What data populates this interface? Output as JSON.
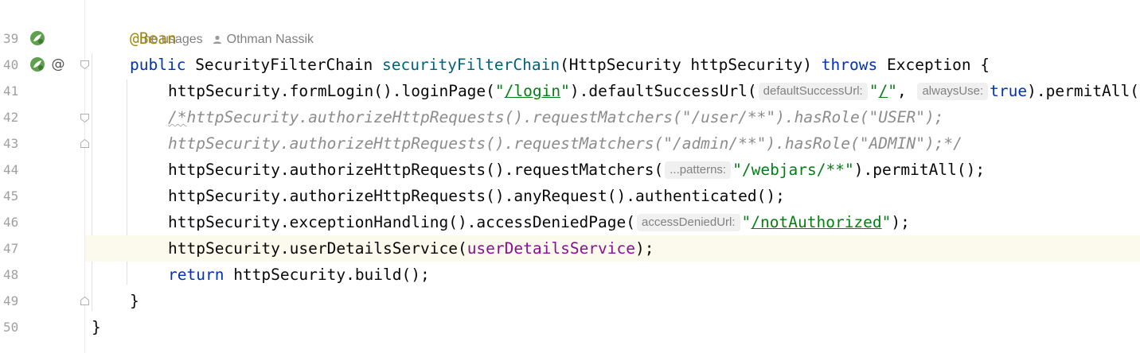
{
  "header_hint": {
    "usages": "no usages",
    "author": "Othman Nassik"
  },
  "line_numbers": [
    "39",
    "40",
    "41",
    "42",
    "43",
    "44",
    "45",
    "46",
    "47",
    "48",
    "49",
    "50"
  ],
  "code": {
    "l39": {
      "ann": "@Bean"
    },
    "l40": {
      "kw1": "public",
      "t1": " SecurityFilterChain ",
      "fn": "securityFilterChain",
      "t2": "(HttpSecurity httpSecurity) ",
      "kw2": "throws",
      "t3": " Exception {"
    },
    "l41": {
      "t1": "httpSecurity.formLogin().loginPage(",
      "s1q": "\"",
      "s1": "/login",
      "s1q2": "\"",
      "t2": ").defaultSuccessUrl(",
      "h1": "defaultSuccessUrl:",
      "s2q": "\"",
      "s2": "/",
      "s2q2": "\"",
      "t3": ", ",
      "h2": "alwaysUse:",
      "kw": "true",
      "t4": ").permitAll();"
    },
    "l42": {
      "c1": "/*",
      "c2": "httpSecurity.authorizeHttpRequests().requestMatchers(\"/user/**\").hasRole(\"USER\");"
    },
    "l43": {
      "c": "httpSecurity.authorizeHttpRequests().requestMatchers(\"/admin/**\").hasRole(\"ADMIN\");*/"
    },
    "l44": {
      "t1": "httpSecurity.authorizeHttpRequests().requestMatchers(",
      "h1": "...patterns:",
      "s1": "\"/webjars/**\"",
      "t2": ").permitAll();"
    },
    "l45": {
      "t1": "httpSecurity.authorizeHttpRequests().anyRequest().authenticated();"
    },
    "l46": {
      "t1": "httpSecurity.exceptionHandling().accessDeniedPage(",
      "h1": "accessDeniedUrl:",
      "sq": "\"",
      "s1": "/notAuthorized",
      "sq2": "\"",
      "t2": ");"
    },
    "l47": {
      "t1": "httpSecurity.userDetailsService(",
      "fld": "userDetailsService",
      "t2": ");"
    },
    "l48": {
      "kw": "return",
      "t1": " httpSecurity.build();"
    },
    "l49": {
      "t1": "}"
    },
    "l50": {
      "t1": "}"
    }
  },
  "icons": [
    "spring-bean-icon",
    "spring-bean-icon",
    "at-sign-icon",
    "fold-start-icon",
    "fold-end-icon"
  ],
  "colors": {
    "keyword": "#0033b3",
    "annotation": "#9e880d",
    "method": "#00627a",
    "string": "#067d17",
    "comment": "#8c8c8c",
    "field": "#871094",
    "current_line": "#fcfaed"
  }
}
